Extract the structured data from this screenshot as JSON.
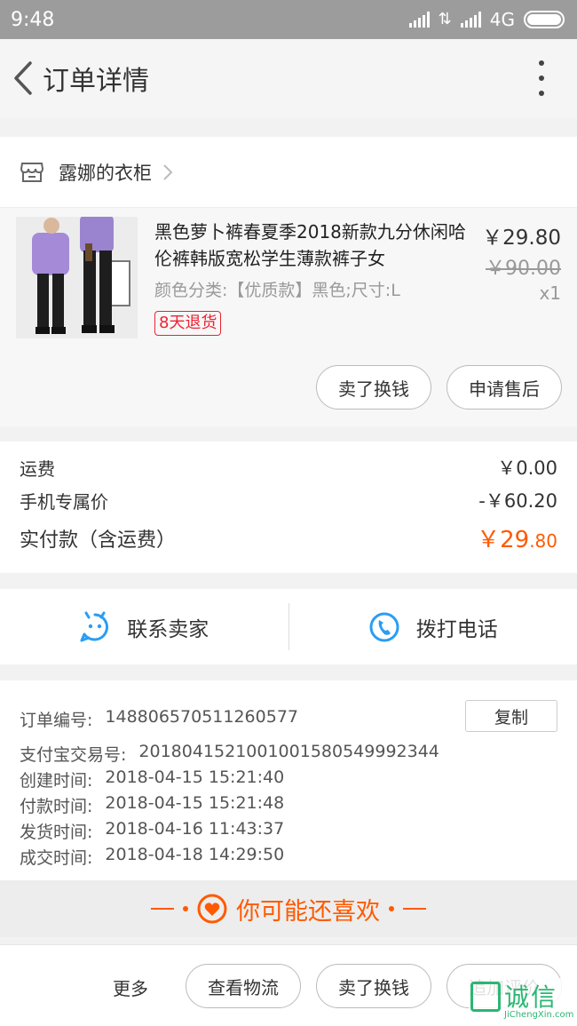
{
  "status_bar": {
    "time": "9:48",
    "network": "4G"
  },
  "header": {
    "title": "订单详情"
  },
  "shop": {
    "name": "露娜的衣柜"
  },
  "product": {
    "title": "黑色萝卜裤春夏季2018新款九分休闲哈伦裤韩版宽松学生薄款裤子女",
    "sku": "颜色分类:【优质款】黑色;尺寸:L",
    "badge": "8天退货",
    "price": "￥29.80",
    "original_price": "￥90.00",
    "quantity": "x1",
    "btn_sell": "卖了换钱",
    "btn_after_sale": "申请售后"
  },
  "totals": {
    "shipping_label": "运费",
    "shipping_value": "￥0.00",
    "mobile_label": "手机专属价",
    "mobile_value": "-￥60.20",
    "paid_label": "实付款（含运费）",
    "paid_int": "￥29",
    "paid_dec": ".80"
  },
  "contact": {
    "seller": "联系卖家",
    "phone": "拨打电话"
  },
  "order_info": {
    "copy": "复制",
    "rows": [
      {
        "k": "订单编号:",
        "v": "148806570511260577"
      },
      {
        "k": "支付宝交易号:",
        "v": "2018041521001001580549992344"
      },
      {
        "k": "创建时间:",
        "v": "2018-04-15 15:21:40"
      },
      {
        "k": "付款时间:",
        "v": "2018-04-15 15:21:48"
      },
      {
        "k": "发货时间:",
        "v": "2018-04-16 11:43:37"
      },
      {
        "k": "成交时间:",
        "v": "2018-04-18 14:29:50"
      }
    ]
  },
  "recommend": {
    "text": "你可能还喜欢"
  },
  "bottom": {
    "more": "更多",
    "logistics": "查看物流",
    "sell": "卖了换钱",
    "review": "追加评价"
  },
  "watermark": {
    "text": "诚信",
    "sub": "JiChengXin.com"
  },
  "colors": {
    "accent": "#ff5a00",
    "icon_blue": "#2a9df4",
    "badge_red": "#ee2233"
  }
}
